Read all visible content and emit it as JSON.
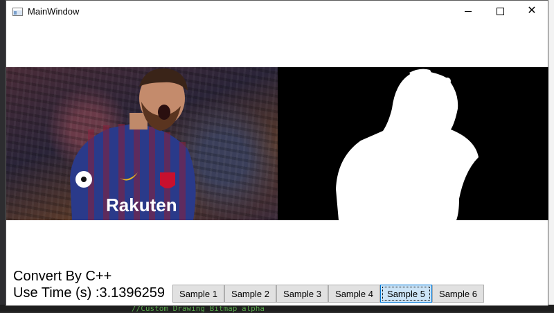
{
  "window": {
    "title": "MainWindow"
  },
  "background": {
    "code_snippet": "//Custom Drawing Bitmap alpha"
  },
  "info": {
    "convert_label": "Convert By C++",
    "time_label": "Use Time (s) :3.1396259"
  },
  "samples": [
    {
      "label": "Sample 1",
      "active": false
    },
    {
      "label": "Sample 2",
      "active": false
    },
    {
      "label": "Sample 3",
      "active": false
    },
    {
      "label": "Sample 4",
      "active": false
    },
    {
      "label": "Sample 5",
      "active": true
    },
    {
      "label": "Sample 6",
      "active": false
    }
  ],
  "images": {
    "original": {
      "caption": "",
      "jersey_text": "Rakuten"
    },
    "mask": {
      "caption": ""
    }
  }
}
